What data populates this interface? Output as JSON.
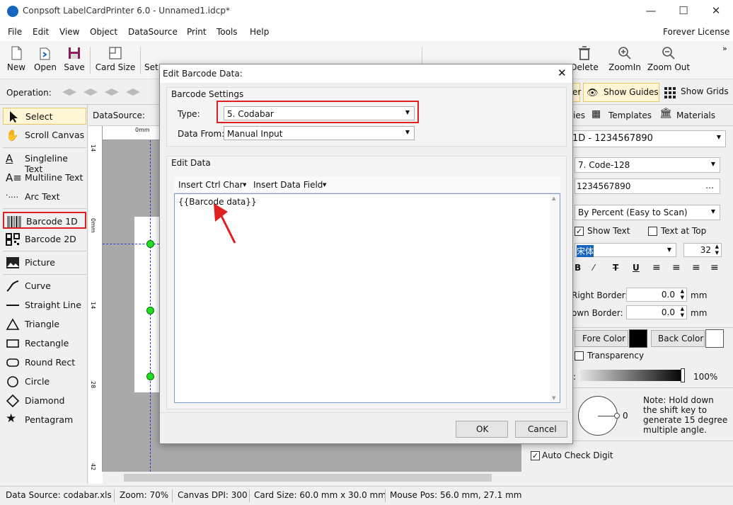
{
  "window": {
    "title": "Conpsoft LabelCardPrinter 6.0 - Unnamed1.idcp*"
  },
  "menu": [
    "File",
    "Edit",
    "View",
    "Object",
    "DataSource",
    "Print",
    "Tools",
    "Help"
  ],
  "license": "Forever License",
  "toolbar": {
    "new": "New",
    "open": "Open",
    "save": "Save",
    "card_size": "Card Size",
    "set": "Set",
    "delete": "Delete",
    "zoom_in": "ZoomIn",
    "zoom_out": "Zoom Out"
  },
  "opbar": {
    "operation": "Operation:",
    "show_guides": "Show Guides",
    "show_grids": "Show Grids",
    "tab_er": "er"
  },
  "tools": [
    {
      "label": "Select",
      "icon": "cursor-icon"
    },
    {
      "label": "Scroll Canvas",
      "icon": "hand-icon"
    },
    {
      "label": "Singleline Text",
      "icon": "singleline-text-icon"
    },
    {
      "label": "Multiline Text",
      "icon": "multiline-text-icon"
    },
    {
      "label": "Arc Text",
      "icon": "arc-text-icon"
    },
    {
      "label": "Barcode 1D",
      "icon": "barcode-icon"
    },
    {
      "label": "Barcode 2D",
      "icon": "qrcode-icon"
    },
    {
      "label": "Picture",
      "icon": "picture-icon"
    },
    {
      "label": "Curve",
      "icon": "curve-icon"
    },
    {
      "label": "Straight Line",
      "icon": "line-icon"
    },
    {
      "label": "Triangle",
      "icon": "triangle-icon"
    },
    {
      "label": "Rectangle",
      "icon": "rectangle-icon"
    },
    {
      "label": "Round Rect",
      "icon": "round-rect-icon"
    },
    {
      "label": "Circle",
      "icon": "circle-icon"
    },
    {
      "label": "Diamond",
      "icon": "diamond-icon"
    },
    {
      "label": "Pentagram",
      "icon": "star-icon"
    }
  ],
  "canvas": {
    "datasource_label": "DataSource:",
    "ruler_top": "0mm",
    "ruler_left": [
      "14",
      "0mm",
      "14",
      "28",
      "42"
    ]
  },
  "right": {
    "tab_ies": "ies",
    "tab_templates": "Templates",
    "tab_materials": "Materials",
    "object_select": "1D - 1234567890",
    "barcode_type": "7.  Code-128",
    "data_value": "1234567890",
    "size_mode": "By Percent (Easy to Scan)",
    "show_text": "Show Text",
    "text_at_top": "Text at Top",
    "font_name": "宋体",
    "font_size": "32",
    "right_border_label": "Right Border:",
    "right_border_value": "0.0",
    "down_border_label": "own Border:",
    "down_border_value": "0.0",
    "unit": "mm",
    "fore_color": "Fore Color",
    "back_color": "Back Color",
    "transparency": "Transparency",
    "opacity_label": ":",
    "opacity_value": "100%",
    "angle_value": "0",
    "note": "Note: Hold down the shift key to generate 15 degree multiple angle.",
    "auto_check_digit": "Auto Check Digit",
    "fore_hex": "#000000",
    "back_hex": "#ffffff"
  },
  "dialog": {
    "title": "Edit Barcode Data:",
    "settings_group": "Barcode Settings",
    "type_label": "Type:",
    "type_value": "5.  Codabar",
    "datafrom_label": "Data From:",
    "datafrom_value": "Manual Input",
    "edit_group": "Edit Data",
    "insert_ctrl": "Insert Ctrl Char",
    "insert_field": "Insert Data Field",
    "editor_text": "{{Barcode data}}",
    "ok": "OK",
    "cancel": "Cancel"
  },
  "status": {
    "datasource": "Data Source: codabar.xls",
    "zoom": "Zoom: 70%",
    "dpi": "Canvas DPI: 300",
    "card_size": "Card Size: 60.0 mm x 30.0 mm",
    "mouse_pos": "Mouse Pos: 56.0 mm, 27.1 mm"
  },
  "colors": {
    "highlight": "#e02020",
    "select_bg": "#fff6d5",
    "accent": "#1565c0"
  }
}
